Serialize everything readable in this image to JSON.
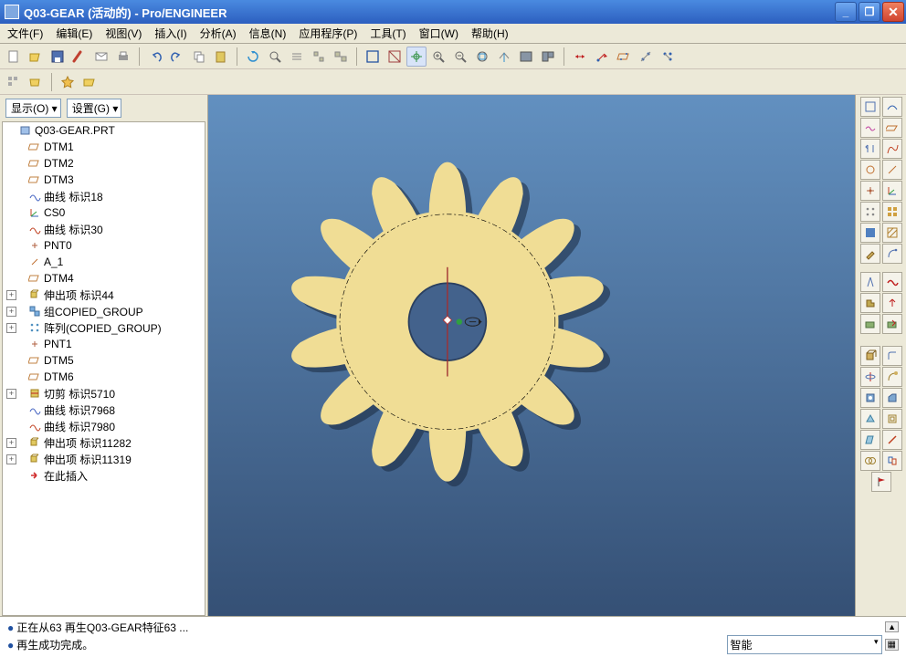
{
  "title": "Q03-GEAR (活动的) - Pro/ENGINEER",
  "menubar": [
    "文件(F)",
    "编辑(E)",
    "视图(V)",
    "插入(I)",
    "分析(A)",
    "信息(N)",
    "应用程序(P)",
    "工具(T)",
    "窗口(W)",
    "帮助(H)"
  ],
  "panel": {
    "display": "显示(O) ▾",
    "settings": "设置(G) ▾"
  },
  "tree": [
    {
      "expand": "",
      "indent": 0,
      "icon": "part",
      "label": "Q03-GEAR.PRT",
      "color": "#7aa8e0"
    },
    {
      "expand": "",
      "indent": 1,
      "icon": "plane",
      "label": "DTM1",
      "color": "#c08040"
    },
    {
      "expand": "",
      "indent": 1,
      "icon": "plane",
      "label": "DTM2",
      "color": "#c08040"
    },
    {
      "expand": "",
      "indent": 1,
      "icon": "plane",
      "label": "DTM3",
      "color": "#c08040"
    },
    {
      "expand": "",
      "indent": 1,
      "icon": "curve",
      "label": "曲线 标识18",
      "color": "#4060c0"
    },
    {
      "expand": "",
      "indent": 1,
      "icon": "csys",
      "label": "CS0",
      "color": "#d06030"
    },
    {
      "expand": "",
      "indent": 1,
      "icon": "curve2",
      "label": "曲线 标识30",
      "color": "#c04020"
    },
    {
      "expand": "",
      "indent": 1,
      "icon": "point",
      "label": "PNT0",
      "color": "#d06030"
    },
    {
      "expand": "",
      "indent": 1,
      "icon": "slash",
      "label": "A_1",
      "color": "#d06030"
    },
    {
      "expand": "",
      "indent": 1,
      "icon": "plane",
      "label": "DTM4",
      "color": "#c08040"
    },
    {
      "expand": "+",
      "indent": 1,
      "icon": "extrude",
      "label": "伸出项 标识44",
      "color": "#d0b030"
    },
    {
      "expand": "+",
      "indent": 1,
      "icon": "group",
      "label": "组COPIED_GROUP",
      "color": "#40a0d0"
    },
    {
      "expand": "+",
      "indent": 1,
      "icon": "pattern",
      "label": "阵列(COPIED_GROUP)",
      "color": "#5090c0"
    },
    {
      "expand": "",
      "indent": 1,
      "icon": "point",
      "label": "PNT1",
      "color": "#d06030"
    },
    {
      "expand": "",
      "indent": 1,
      "icon": "plane",
      "label": "DTM5",
      "color": "#c08040"
    },
    {
      "expand": "",
      "indent": 1,
      "icon": "plane",
      "label": "DTM6",
      "color": "#c08040"
    },
    {
      "expand": "+",
      "indent": 1,
      "icon": "cut",
      "label": "切剪 标识5710",
      "color": "#d0b030"
    },
    {
      "expand": "",
      "indent": 1,
      "icon": "curve",
      "label": "曲线 标识7968",
      "color": "#4060c0"
    },
    {
      "expand": "",
      "indent": 1,
      "icon": "curve2",
      "label": "曲线 标识7980",
      "color": "#c04020"
    },
    {
      "expand": "+",
      "indent": 1,
      "icon": "extrude",
      "label": "伸出项 标识11282",
      "color": "#d0b030"
    },
    {
      "expand": "+",
      "indent": 1,
      "icon": "extrude",
      "label": "伸出项 标识11319",
      "color": "#d0b030"
    },
    {
      "expand": "",
      "indent": 1,
      "icon": "insert",
      "label": "在此插入",
      "color": "#d03030"
    }
  ],
  "status": {
    "line1": "正在从63 再生Q03-GEAR特征63 ...",
    "line2": "再生成功完成。",
    "sel_label": "智能"
  },
  "window_buttons": {
    "min": "_",
    "max": "❐",
    "close": "✕"
  }
}
